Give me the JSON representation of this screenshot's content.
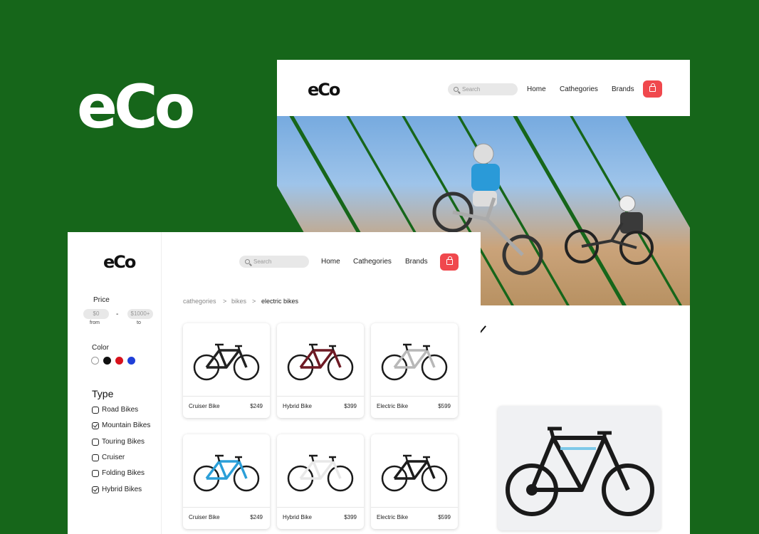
{
  "brand": {
    "logo_text": "eCo",
    "bg_color": "#16661a",
    "accent_color": "#f0484d"
  },
  "back_window": {
    "search_placeholder": "Search",
    "nav": [
      "Home",
      "Cathegories",
      "Brands"
    ]
  },
  "front_window": {
    "search_placeholder": "Search",
    "nav": [
      "Home",
      "Cathegories",
      "Brands"
    ],
    "breadcrumb": [
      "cathegories",
      ">",
      "bikes",
      ">",
      "electric bikes"
    ],
    "filters": {
      "price_label": "Price",
      "price_from_value": "$0",
      "price_from_label": "from",
      "price_sep": "-",
      "price_to_value": "$1000+",
      "price_to_label": "to",
      "color_label": "Color",
      "colors": [
        "#ffffff",
        "#111111",
        "#d8121c",
        "#1f3fd8"
      ],
      "type_label": "Type",
      "types": [
        {
          "label": "Road Bikes",
          "checked": false
        },
        {
          "label": "Mountain Bikes",
          "checked": true
        },
        {
          "label": "Touring Bikes",
          "checked": false
        },
        {
          "label": "Cruiser",
          "checked": false
        },
        {
          "label": "Folding Bikes",
          "checked": false
        },
        {
          "label": "Hybrid Bikes",
          "checked": true
        }
      ]
    },
    "products": [
      {
        "name": "Cruiser Bike",
        "price": "$249",
        "frame_color": "#222222"
      },
      {
        "name": "Hybrid Bike",
        "price": "$399",
        "frame_color": "#6e1a24"
      },
      {
        "name": "Electric Bike",
        "price": "$599",
        "frame_color": "#b8b8b8"
      },
      {
        "name": "Cruiser Bike",
        "price": "$249",
        "frame_color": "#2b9fd8"
      },
      {
        "name": "Hybrid Bike",
        "price": "$399",
        "frame_color": "#e8e8e8"
      },
      {
        "name": "Electric Bike",
        "price": "$599",
        "frame_color": "#1c1c1c"
      }
    ]
  }
}
